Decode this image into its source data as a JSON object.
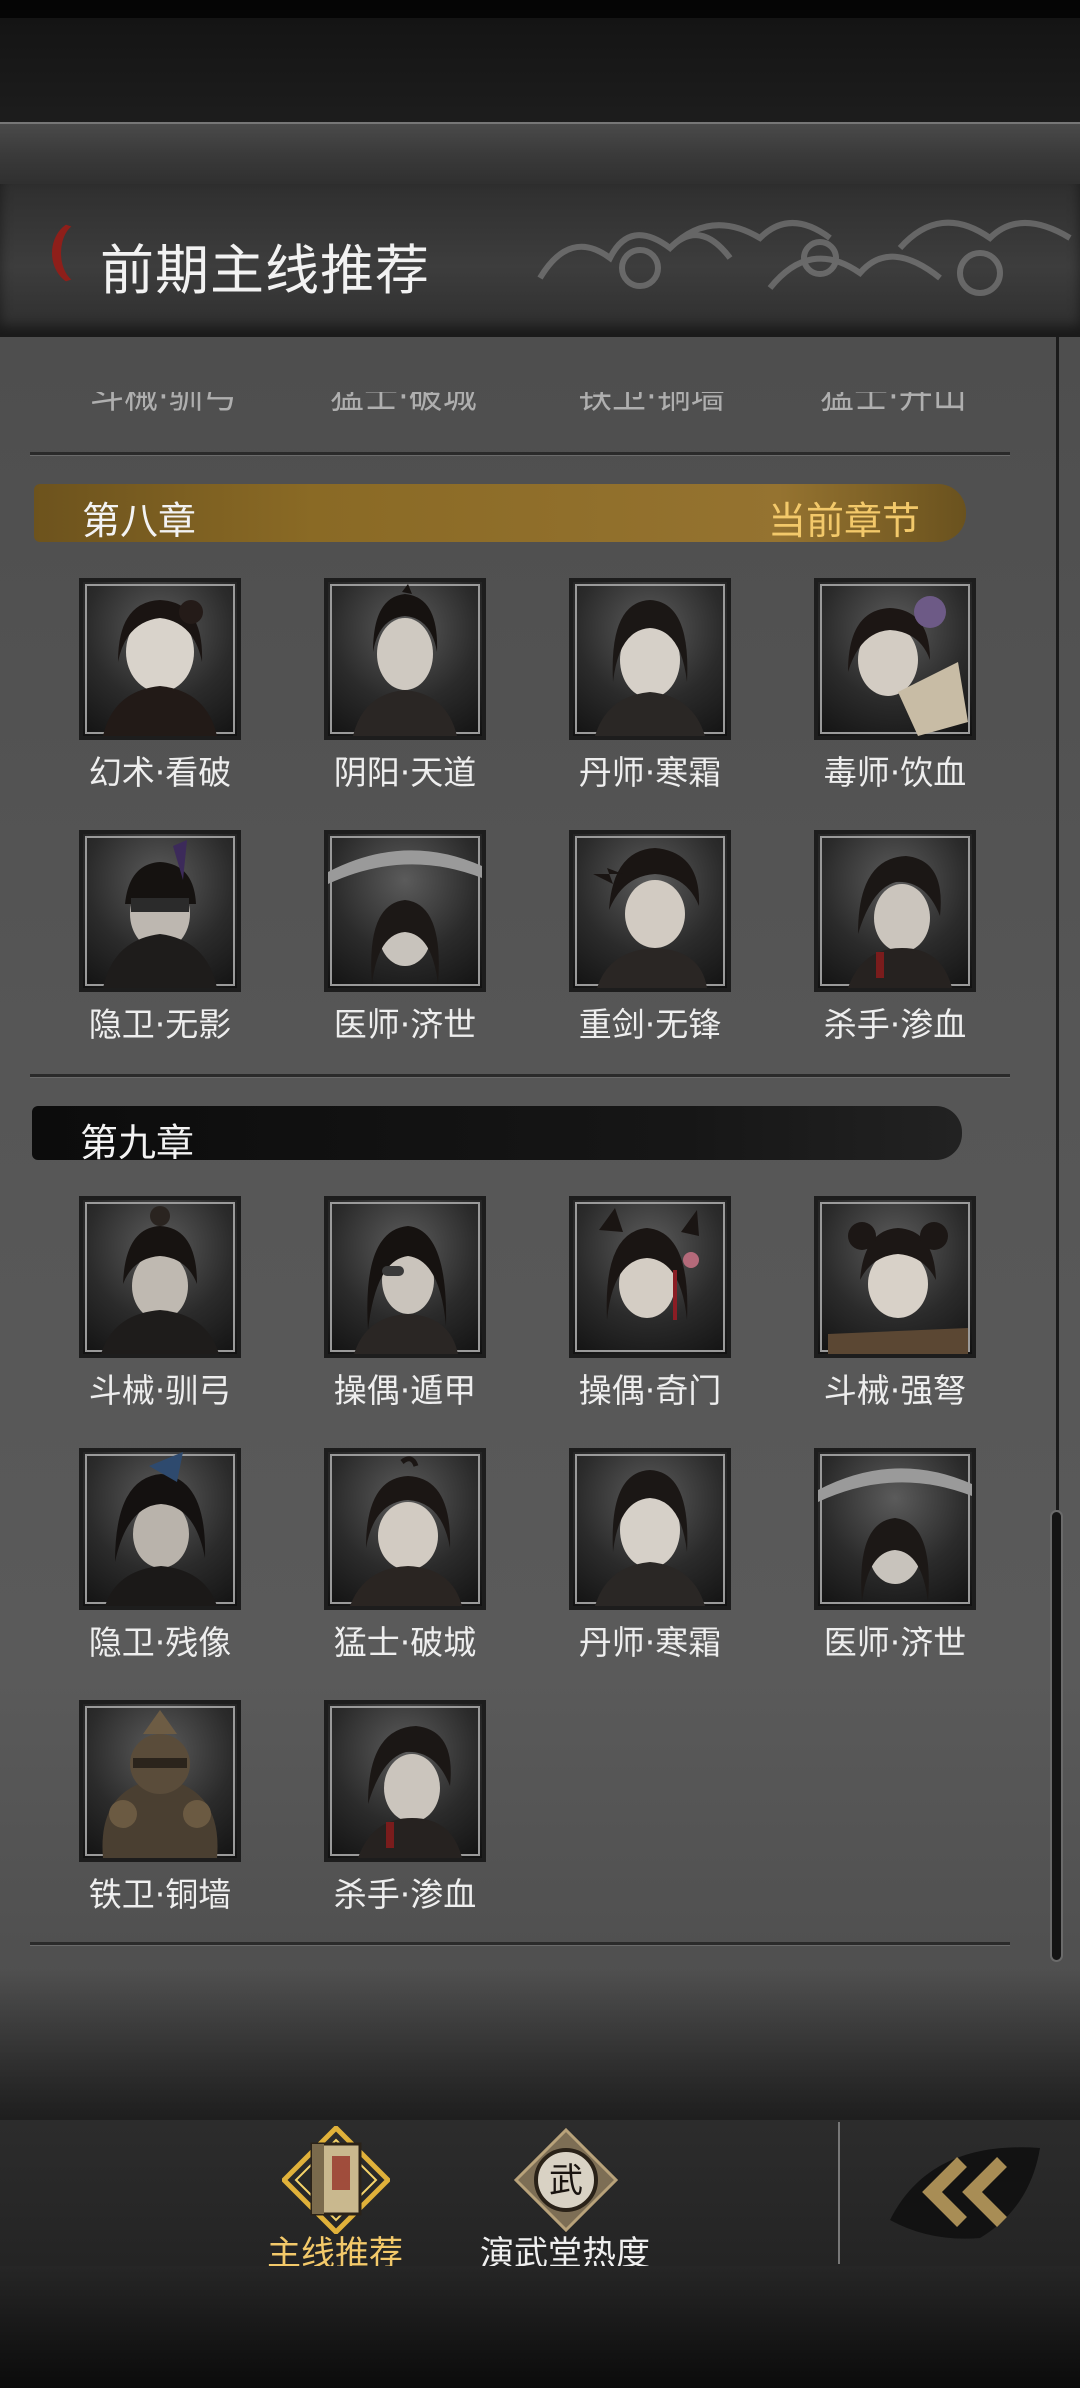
{
  "header": {
    "title": "前期主线推荐"
  },
  "cut_row": [
    "斗械·驯弓",
    "猛士·破城",
    "铁卫·铜墙",
    "猛士·开山"
  ],
  "chapters": [
    {
      "title": "第八章",
      "badge": "当前章节",
      "heroes": [
        "幻术·看破",
        "阴阳·天道",
        "丹师·寒霜",
        "毒师·饮血",
        "隐卫·无影",
        "医师·济世",
        "重剑·无锋",
        "杀手·渗血"
      ]
    },
    {
      "title": "第九章",
      "badge": "",
      "heroes": [
        "斗械·驯弓",
        "操偶·遁甲",
        "操偶·奇门",
        "斗械·强弩",
        "隐卫·残像",
        "猛士·破城",
        "丹师·寒霜",
        "医师·济世",
        "铁卫·铜墙",
        "杀手·渗血"
      ]
    }
  ],
  "nav": [
    {
      "label": "主线推荐",
      "active": true,
      "icon": "scroll-book-icon"
    },
    {
      "label": "演武堂热度",
      "active": false,
      "icon": "wu-emblem-icon",
      "glyph": "武"
    }
  ],
  "colors": {
    "gold": "#f3c96a",
    "accent_red": "#8e1f1a",
    "chapter_gold": "#8a6a25"
  }
}
